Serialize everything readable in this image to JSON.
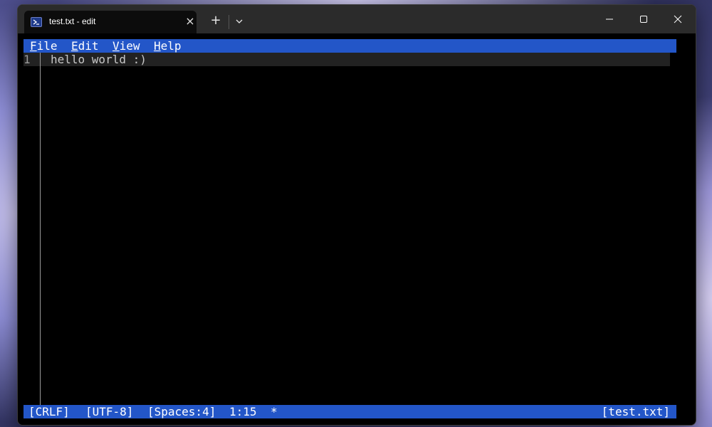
{
  "tab": {
    "icon": "powershell-icon",
    "title": "test.txt - edit",
    "close_glyph": "×"
  },
  "titlebar": {
    "new_tab_glyph": "+",
    "dropdown_icon": "chevron-down-icon",
    "minimize_icon": "minimize-icon",
    "maximize_icon": "maximize-icon",
    "close_icon": "close-icon"
  },
  "menu": {
    "file": {
      "mnemonic": "F",
      "rest": "ile"
    },
    "edit": {
      "mnemonic": "E",
      "rest": "dit"
    },
    "view": {
      "mnemonic": "V",
      "rest": "iew"
    },
    "help": {
      "mnemonic": "H",
      "rest": "elp"
    }
  },
  "editor": {
    "lines": [
      {
        "number": "1",
        "text": "hello world :)"
      }
    ]
  },
  "status": {
    "eol": "[CRLF]",
    "encoding": "[UTF-8]",
    "indent": "[Spaces:4]",
    "position": "1:15",
    "modified": "*",
    "filename": "[test.txt]"
  },
  "colors": {
    "bar_blue": "#2356c8",
    "terminal_bg": "#000000",
    "titlebar_bg": "#2b2b2b"
  }
}
